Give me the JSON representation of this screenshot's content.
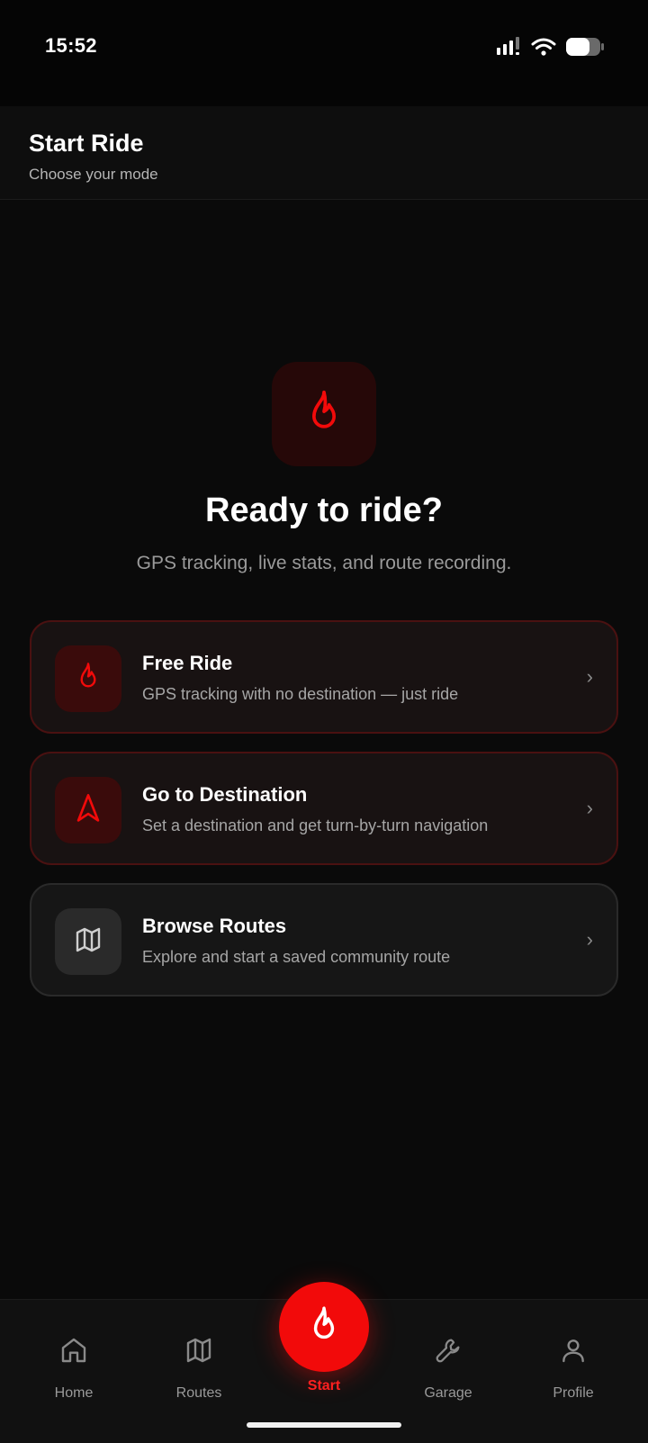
{
  "status_bar": {
    "time": "15:52",
    "icons": [
      "signal-icon",
      "wifi-icon",
      "battery-icon"
    ]
  },
  "header": {
    "title": "Start Ride",
    "subtitle": "Choose your mode"
  },
  "hero": {
    "icon": "flame-icon",
    "title": "Ready to ride?",
    "subtitle": "GPS tracking, live stats, and route recording."
  },
  "modes": [
    {
      "title": "Free Ride",
      "description": "GPS tracking with no destination — just ride",
      "icon": "flame-icon",
      "chevron": "›"
    },
    {
      "title": "Go to Destination",
      "description": "Set a destination and get turn-by-turn navigation",
      "icon": "navigation-arrow-icon",
      "chevron": "›"
    },
    {
      "title": "Browse Routes",
      "description": "Explore and start a saved community route",
      "icon": "map-icon",
      "chevron": "›"
    }
  ],
  "bottom_nav": {
    "items": [
      {
        "label": "Home",
        "icon": "home-icon"
      },
      {
        "label": "Routes",
        "icon": "map-icon"
      },
      {
        "label": "Start",
        "icon": "flame-icon",
        "active": true
      },
      {
        "label": "Garage",
        "icon": "wrench-icon"
      },
      {
        "label": "Profile",
        "icon": "person-icon"
      }
    ]
  },
  "colors": {
    "accent": "#f20a0a",
    "background": "#0a0a0a",
    "card": "#161616",
    "muted_text": "#9a9a9a"
  }
}
